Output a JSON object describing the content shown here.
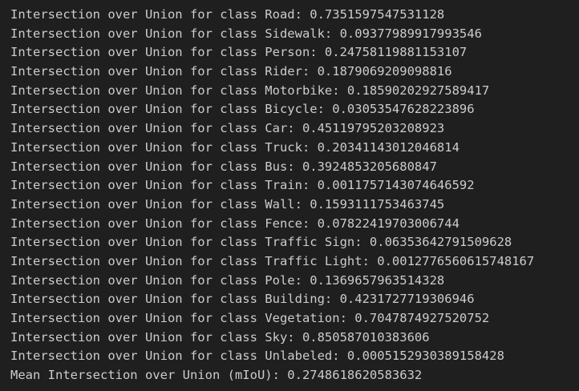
{
  "output": {
    "lines": [
      "Intersection over Union for class Road: 0.7351597547531128",
      "Intersection over Union for class Sidewalk: 0.09377989917993546",
      "Intersection over Union for class Person: 0.24758119881153107",
      "Intersection over Union for class Rider: 0.1879069209098816",
      "Intersection over Union for class Motorbike: 0.18590202927589417",
      "Intersection over Union for class Bicycle: 0.03053547628223896",
      "Intersection over Union for class Car: 0.45119795203208923",
      "Intersection over Union for class Truck: 0.20341143012046814",
      "Intersection over Union for class Bus: 0.3924853205680847",
      "Intersection over Union for class Train: 0.0011757143074646592",
      "Intersection over Union for class Wall: 0.1593111753463745",
      "Intersection over Union for class Fence: 0.07822419703006744",
      "Intersection over Union for class Traffic Sign: 0.06353642791509628",
      "Intersection over Union for class Traffic Light: 0.0012776560615748167",
      "Intersection over Union for class Pole: 0.1369657963514328",
      "Intersection over Union for class Building: 0.4231727719306946",
      "Intersection over Union for class Vegetation: 0.7047874927520752",
      "Intersection over Union for class Sky: 0.850587010383606",
      "Intersection over Union for class Unlabeled: 0.0005152930389158428",
      "Mean Intersection over Union (mIoU): 0.2748618620583632"
    ]
  },
  "colors": {
    "background": "#1f1f1f",
    "text": "#cccccc"
  }
}
